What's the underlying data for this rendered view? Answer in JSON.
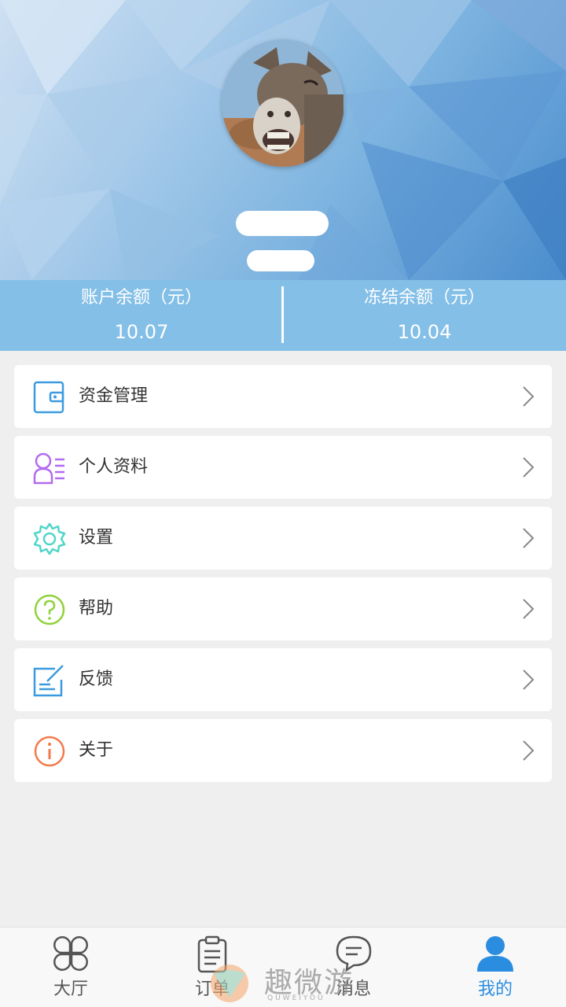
{
  "balance": {
    "account_label": "账户余额（元）",
    "account_value": "10.07",
    "frozen_label": "冻结余额（元）",
    "frozen_value": "10.04"
  },
  "menu": [
    {
      "label": "资金管理",
      "icon": "wallet-icon",
      "color": "#3b9be0"
    },
    {
      "label": "个人资料",
      "icon": "profile-list-icon",
      "color": "#b36bf0"
    },
    {
      "label": "设置",
      "icon": "gear-icon",
      "color": "#4fd6c8"
    },
    {
      "label": "帮助",
      "icon": "question-circle-icon",
      "color": "#8fd23a"
    },
    {
      "label": "反馈",
      "icon": "edit-feedback-icon",
      "color": "#3b9be0"
    },
    {
      "label": "关于",
      "icon": "info-circle-icon",
      "color": "#f37a4a"
    }
  ],
  "nav": [
    {
      "label": "大厅",
      "icon": "four-leaf-grid-icon"
    },
    {
      "label": "订单",
      "icon": "clipboard-icon"
    },
    {
      "label": "消息",
      "icon": "chat-bubble-icon"
    },
    {
      "label": "我的",
      "icon": "user-icon",
      "active": true
    }
  ],
  "watermark": {
    "text": "趣微游",
    "sub": "QUWEIYOU"
  },
  "colors": {
    "accent": "#2b8de0",
    "balance_bar": "#84bfe7",
    "background": "#efefef"
  }
}
